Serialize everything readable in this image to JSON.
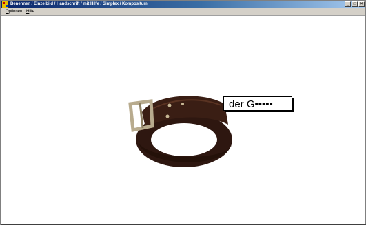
{
  "window": {
    "title": "Benennen / Einzelbild / Handschrift / mit Hilfe / Simplex / Kompositum"
  },
  "menu": {
    "items": [
      {
        "first": "O",
        "rest": "ptionen"
      },
      {
        "first": "H",
        "rest": "ilfe"
      }
    ]
  },
  "controls": {
    "minimize": "_",
    "maximize": "□",
    "close": "×"
  },
  "task": {
    "image": "belt-picture",
    "answer": "der G•••••"
  },
  "colors": {
    "titlebar_start": "#0a246a",
    "titlebar_end": "#a6caf0",
    "belt": "#2e1710",
    "buckle": "#b8ab8e"
  }
}
